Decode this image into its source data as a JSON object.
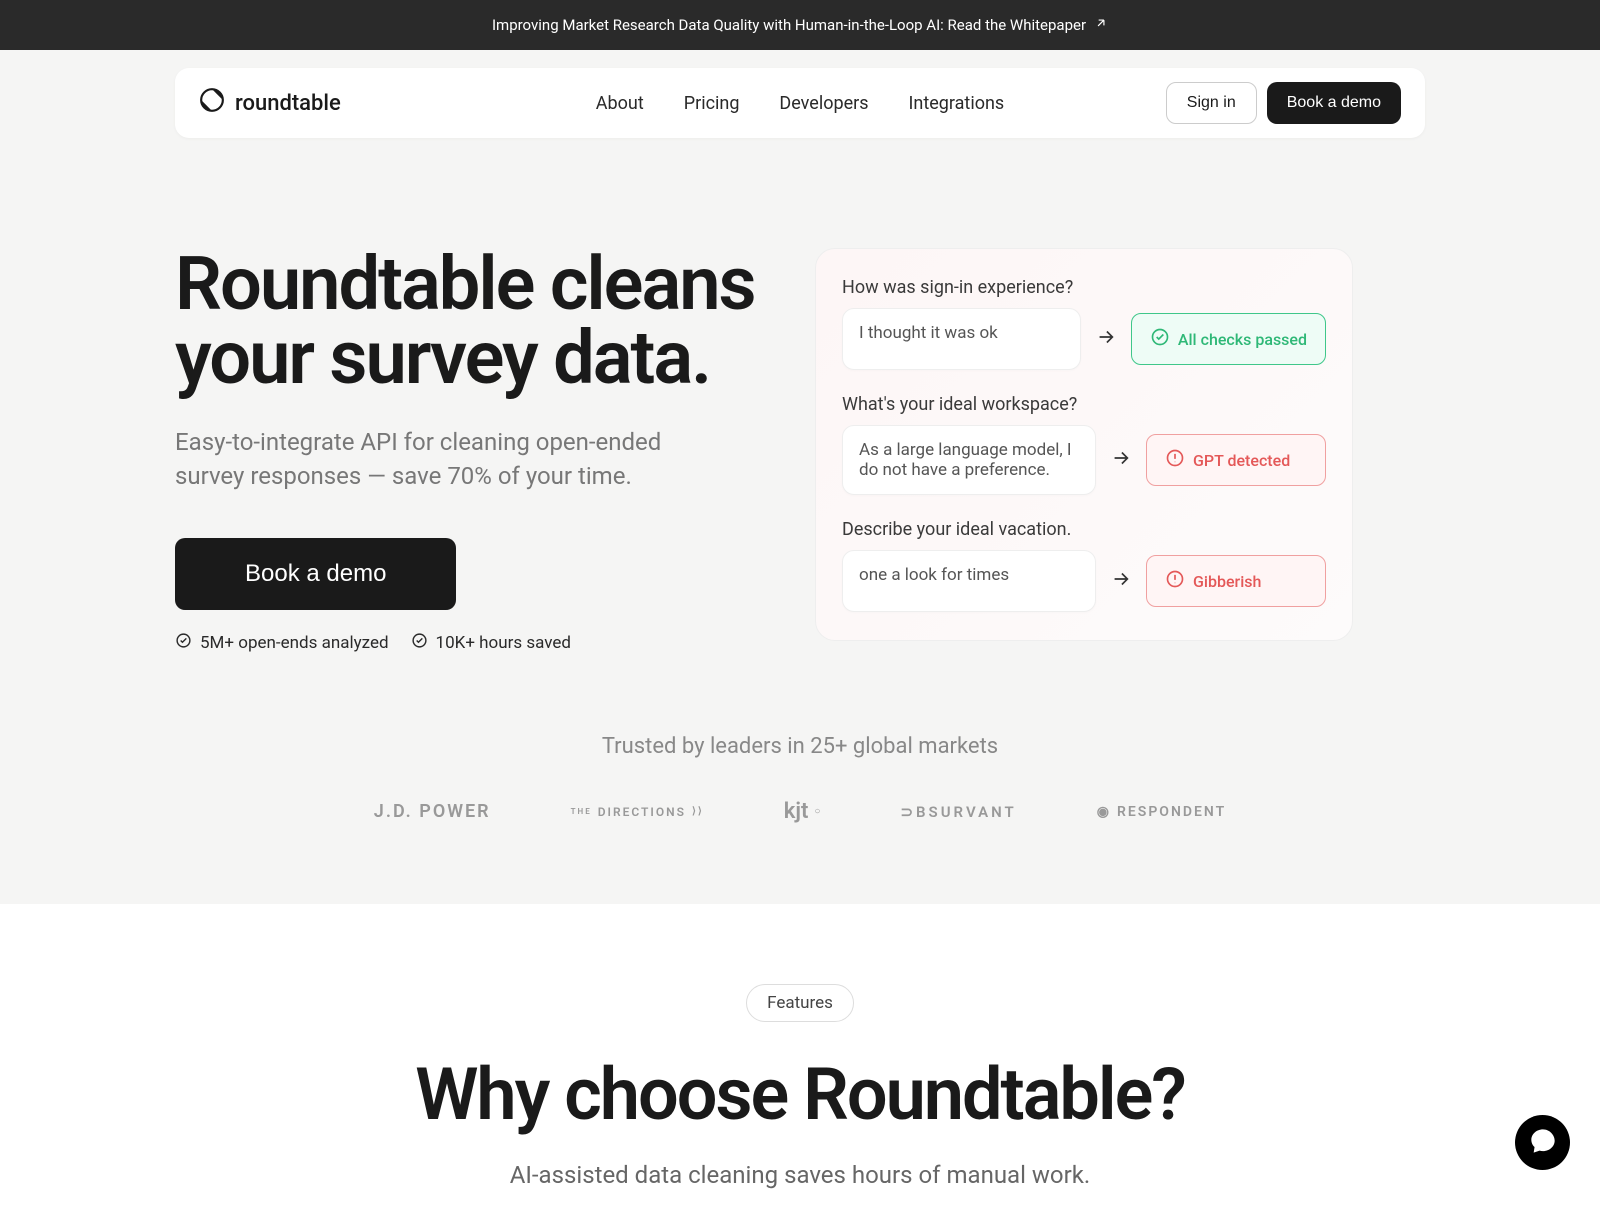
{
  "announcement": {
    "text": "Improving Market Research Data Quality with Human-in-the-Loop AI: Read the Whitepaper"
  },
  "brand": {
    "name": "roundtable"
  },
  "nav": {
    "links": [
      "About",
      "Pricing",
      "Developers",
      "Integrations"
    ],
    "signin": "Sign in",
    "demo": "Book a demo"
  },
  "hero": {
    "title": "Roundtable cleans your survey data.",
    "subtitle": "Easy-to-integrate API for cleaning open-ended survey responses — save 70% of your time.",
    "cta": "Book a demo",
    "stats": [
      "5M+ open-ends analyzed",
      "10K+ hours saved"
    ]
  },
  "demo": {
    "rows": [
      {
        "question": "How was sign-in experience?",
        "response": "I thought it was ok",
        "result": "All checks passed",
        "status": "pass"
      },
      {
        "question": "What's your ideal workspace?",
        "response": "As a large language model, I do not have a preference.",
        "result": "GPT detected",
        "status": "fail"
      },
      {
        "question": "Describe your ideal vacation.",
        "response": "one a look for times",
        "result": "Gibberish",
        "status": "fail"
      }
    ]
  },
  "trusted": {
    "text": "Trusted by leaders in 25+ global markets",
    "logos": [
      "J.D. POWER",
      "THE DIRECTIONS GROUP",
      "kjt",
      "OBSURVANT",
      "RESPONDENT"
    ]
  },
  "features": {
    "badge": "Features",
    "title": "Why choose Roundtable?",
    "subtitle": "AI-assisted data cleaning saves hours of manual work."
  }
}
